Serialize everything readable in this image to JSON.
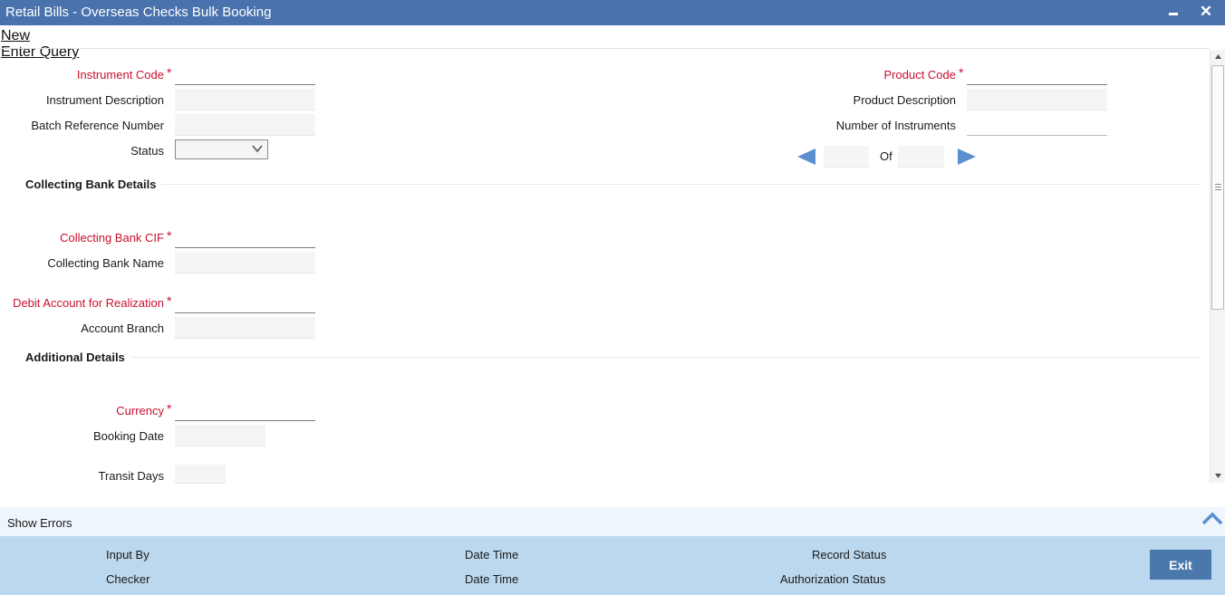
{
  "window": {
    "title": "Retail Bills - Overseas Checks Bulk Booking",
    "close_glyph": "✕"
  },
  "menu": {
    "new_label": "New",
    "enter_query_label": "Enter Query"
  },
  "header_fields": {
    "instrument_code_label": "Instrument Code",
    "instrument_description_label": "Instrument Description",
    "batch_reference_number_label": "Batch Reference Number",
    "status_label": "Status",
    "product_code_label": "Product Code",
    "product_description_label": "Product Description",
    "number_of_instruments_label": "Number of Instruments",
    "of_label": "Of",
    "required_marker": "*"
  },
  "collecting_bank": {
    "section_title": "Collecting Bank Details",
    "cif_label": "Collecting Bank CIF",
    "name_label": "Collecting Bank Name",
    "debit_account_label": "Debit Account for Realization",
    "account_branch_label": "Account Branch"
  },
  "additional": {
    "section_title": "Additional Details",
    "currency_label": "Currency",
    "booking_date_label": "Booking Date",
    "transit_days_label": "Transit Days"
  },
  "errors_bar": {
    "show_errors_label": "Show Errors"
  },
  "footer": {
    "input_by_label": "Input By",
    "checker_label": "Checker",
    "date_time_label_1": "Date Time",
    "date_time_label_2": "Date Time",
    "record_status_label": "Record Status",
    "authorization_status_label": "Authorization Status",
    "exit_label": "Exit"
  },
  "icons": {
    "minimize": "minimize-icon",
    "close": "close-icon",
    "prev": "arrow-left-icon",
    "next": "arrow-right-icon",
    "dropdown": "chevron-down-icon",
    "collapse": "chevron-up-icon"
  },
  "colors": {
    "titlebar": "#4a72ad",
    "required_label": "#c8102e",
    "nav_arrow": "#5b8fd0",
    "footer": "#bcd8ee",
    "exit_button": "#4a78ad"
  }
}
